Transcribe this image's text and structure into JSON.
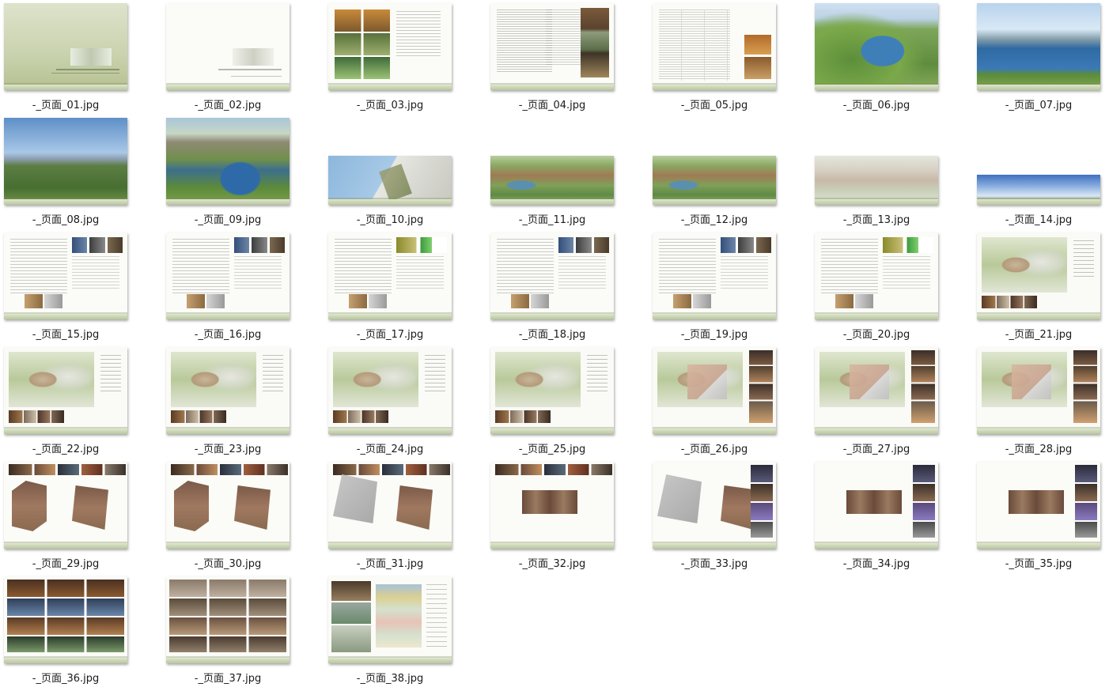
{
  "files": [
    {
      "name": "-_页面_01.jpg",
      "thumb": "cover",
      "orient": "landscape"
    },
    {
      "name": "-_页面_02.jpg",
      "thumb": "blank",
      "orient": "landscape"
    },
    {
      "name": "-_页面_03.jpg",
      "thumb": "collage",
      "orient": "landscape"
    },
    {
      "name": "-_页面_04.jpg",
      "thumb": "text",
      "orient": "landscape"
    },
    {
      "name": "-_页面_05.jpg",
      "thumb": "table",
      "orient": "landscape"
    },
    {
      "name": "-_页面_06.jpg",
      "thumb": "aerial",
      "orient": "landscape"
    },
    {
      "name": "-_页面_07.jpg",
      "thumb": "aerial2",
      "orient": "landscape"
    },
    {
      "name": "-_页面_08.jpg",
      "thumb": "golf",
      "orient": "landscape"
    },
    {
      "name": "-_页面_09.jpg",
      "thumb": "resort",
      "orient": "landscape"
    },
    {
      "name": "-_页面_10.jpg",
      "thumb": "map",
      "orient": "wide"
    },
    {
      "name": "-_页面_11.jpg",
      "thumb": "masterplan",
      "orient": "wide"
    },
    {
      "name": "-_页面_12.jpg",
      "thumb": "masterplan",
      "orient": "wide"
    },
    {
      "name": "-_页面_13.jpg",
      "thumb": "masterplan2",
      "orient": "wide"
    },
    {
      "name": "-_页面_14.jpg",
      "thumb": "panorama",
      "orient": "panorama"
    },
    {
      "name": "-_页面_15.jpg",
      "thumb": "tp",
      "orient": "landscape"
    },
    {
      "name": "-_页面_16.jpg",
      "thumb": "tp",
      "orient": "landscape"
    },
    {
      "name": "-_页面_17.jpg",
      "thumb": "tp-green",
      "orient": "landscape"
    },
    {
      "name": "-_页面_18.jpg",
      "thumb": "tp",
      "orient": "landscape"
    },
    {
      "name": "-_页面_19.jpg",
      "thumb": "tp",
      "orient": "landscape"
    },
    {
      "name": "-_页面_20.jpg",
      "thumb": "tp-green",
      "orient": "landscape"
    },
    {
      "name": "-_页面_21.jpg",
      "thumb": "plan",
      "orient": "landscape"
    },
    {
      "name": "-_页面_22.jpg",
      "thumb": "plan",
      "orient": "landscape"
    },
    {
      "name": "-_页面_23.jpg",
      "thumb": "plan",
      "orient": "landscape"
    },
    {
      "name": "-_页面_24.jpg",
      "thumb": "plan",
      "orient": "landscape"
    },
    {
      "name": "-_页面_25.jpg",
      "thumb": "plan",
      "orient": "landscape"
    },
    {
      "name": "-_页面_26.jpg",
      "thumb": "plan-photo",
      "orient": "landscape"
    },
    {
      "name": "-_页面_27.jpg",
      "thumb": "plan-photo",
      "orient": "landscape"
    },
    {
      "name": "-_页面_28.jpg",
      "thumb": "plan-photo",
      "orient": "landscape"
    },
    {
      "name": "-_页面_29.jpg",
      "thumb": "floor",
      "orient": "landscape"
    },
    {
      "name": "-_页面_30.jpg",
      "thumb": "floor",
      "orient": "landscape"
    },
    {
      "name": "-_页面_31.jpg",
      "thumb": "floor-gray",
      "orient": "landscape"
    },
    {
      "name": "-_页面_32.jpg",
      "thumb": "floor-sym",
      "orient": "landscape"
    },
    {
      "name": "-_页面_33.jpg",
      "thumb": "floor-gray2",
      "orient": "landscape"
    },
    {
      "name": "-_页面_34.jpg",
      "thumb": "floor-col",
      "orient": "landscape"
    },
    {
      "name": "-_页面_35.jpg",
      "thumb": "floor-col",
      "orient": "landscape"
    },
    {
      "name": "-_页面_36.jpg",
      "thumb": "mosaic",
      "orient": "landscape"
    },
    {
      "name": "-_页面_37.jpg",
      "thumb": "mosaic-light",
      "orient": "landscape"
    },
    {
      "name": "-_页面_38.jpg",
      "thumb": "mix",
      "orient": "landscape"
    }
  ]
}
